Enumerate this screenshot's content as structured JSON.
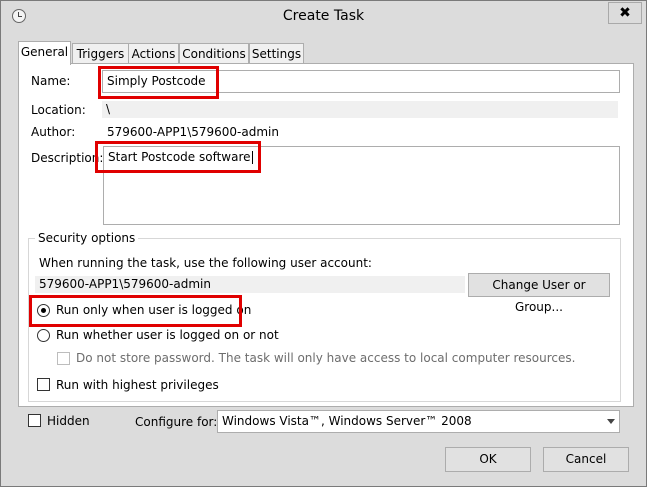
{
  "window": {
    "title": "Create Task",
    "close_icon": "✖"
  },
  "tabs": [
    {
      "label": "General"
    },
    {
      "label": "Triggers"
    },
    {
      "label": "Actions"
    },
    {
      "label": "Conditions"
    },
    {
      "label": "Settings"
    }
  ],
  "general": {
    "name_label": "Name:",
    "name_value": "Simply Postcode",
    "location_label": "Location:",
    "location_value": "\\",
    "author_label": "Author:",
    "author_value": "579600-APP1\\579600-admin",
    "description_label": "Description:",
    "description_value": "Start Postcode software"
  },
  "security": {
    "group_title": "Security options",
    "account_prompt": "When running the task, use the following user account:",
    "account_value": "579600-APP1\\579600-admin",
    "change_user_button": "Change User or Group...",
    "radio_logged_on": "Run only when user is logged on",
    "radio_whether": "Run whether user is logged on or not",
    "do_not_store": "Do not store password.  The task will only have access to local computer resources.",
    "highest_privileges": "Run with highest privileges"
  },
  "bottom": {
    "hidden_label": "Hidden",
    "configure_label": "Configure for:",
    "configure_value": "Windows Vista™, Windows Server™ 2008",
    "ok_button": "OK",
    "cancel_button": "Cancel"
  },
  "highlight_color": "#e00000"
}
